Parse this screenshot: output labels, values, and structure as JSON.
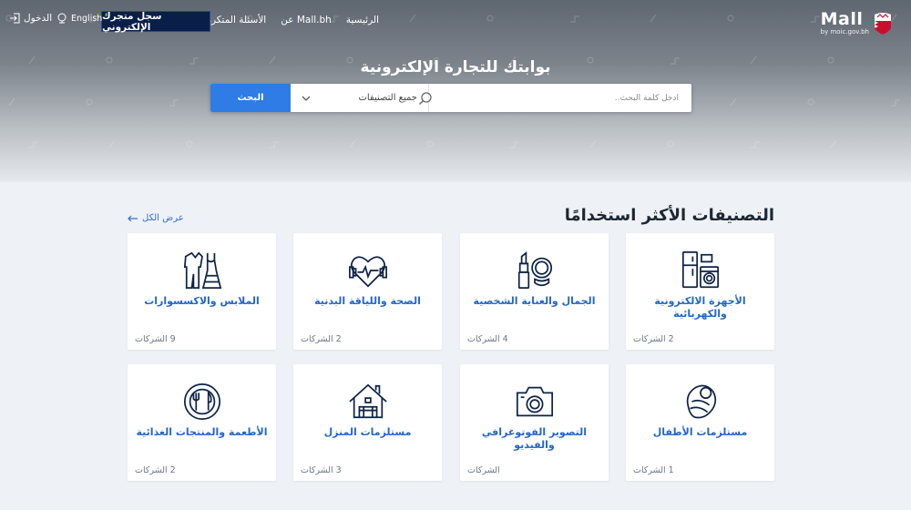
{
  "header": {
    "logo_text": "Mall",
    "logo_sub": "by moic.gov.bh",
    "nav": [
      "الرئيسية",
      "عن Mall.bh",
      "الأسئلة المتكررة"
    ],
    "register_label": "سجل متجرك الإلكتروني",
    "language_label": "English",
    "login_label": "الدخول"
  },
  "hero": {
    "title": "بوابتك للتجارة الإلكترونية"
  },
  "search": {
    "placeholder": "أدخل كلمة البحث..",
    "category_selected": "جميع التصنيفات",
    "button_label": "البحث"
  },
  "section": {
    "title": "التصنيفات الأكثر استخدامًا",
    "view_all": "عرض الكل"
  },
  "categories": [
    {
      "name": "الأجهزة الالكترونية والكهربائية",
      "count": "2",
      "count_label": "الشركات",
      "icon": "appliances-icon"
    },
    {
      "name": "الجمال والعناية الشخصية",
      "count": "4",
      "count_label": "الشركات",
      "icon": "lipstick-mirror-icon"
    },
    {
      "name": "الصحة واللياقة البدنية",
      "count": "2",
      "count_label": "الشركات",
      "icon": "heart-dumbbell-icon"
    },
    {
      "name": "الملابس والاكسسوارات",
      "count": "9",
      "count_label": "الشركات",
      "icon": "clothes-icon"
    },
    {
      "name": "مستلزمات الأطفال",
      "count": "1",
      "count_label": "الشركات",
      "icon": "baby-icon"
    },
    {
      "name": "التصوير الفوتوغرافي والفيديو",
      "count": "",
      "count_label": "الشركات",
      "icon": "camera-icon"
    },
    {
      "name": "مستلزمات المنزل",
      "count": "3",
      "count_label": "الشركات",
      "icon": "house-icon"
    },
    {
      "name": "الأطعمة والمنتجات الغذائية",
      "count": "2",
      "count_label": "الشركات",
      "icon": "food-plate-icon"
    }
  ],
  "colors": {
    "accent": "#2f7ce6",
    "register_bg": "#0a1e4a",
    "category_text": "#2266cc"
  }
}
